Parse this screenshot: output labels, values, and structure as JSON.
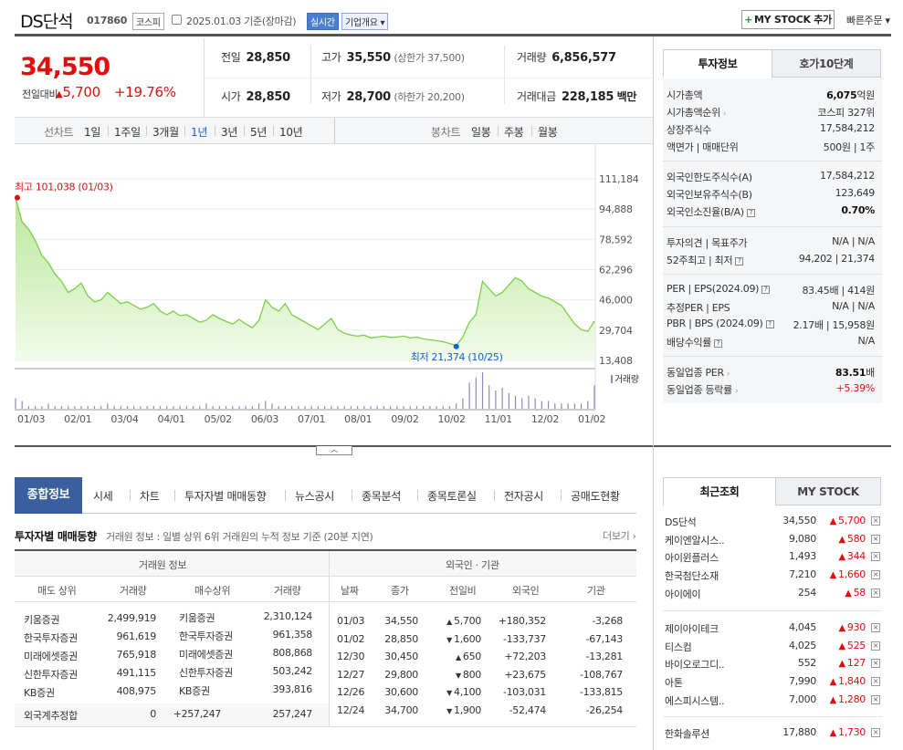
{
  "header": {
    "name": "DS단석",
    "code": "017860",
    "market": "코스피",
    "date": "2025.01.03 기준(장마감)",
    "realtime": "실시간",
    "company_info": "기업개요",
    "mystock": "MY STOCK 추가",
    "quick_order": "빠른주문"
  },
  "price": {
    "current": "34,550",
    "change_label": "전일대비",
    "change": "5,700",
    "change_pct": "+19.76%"
  },
  "quotes": {
    "prev_label": "전일",
    "prev": "28,850",
    "high_label": "고가",
    "high": "35,550",
    "upper_limit": "(상한가 37,500)",
    "volume_label": "거래량",
    "volume": "6,856,577",
    "open_label": "시가",
    "open": "28,850",
    "low_label": "저가",
    "low": "28,700",
    "lower_limit": "(하한가 20,200)",
    "amount_label": "거래대금",
    "amount": "228,185",
    "amount_unit": "백만"
  },
  "period_bar": {
    "line_label": "선차트",
    "line_items": [
      "1일",
      "1주일",
      "3개월",
      "1년",
      "3년",
      "5년",
      "10년"
    ],
    "active": "1년",
    "candle_label": "봉차트",
    "candle_items": [
      "일봉",
      "주봉",
      "월봉"
    ]
  },
  "chart_data": {
    "type": "area",
    "y_ticks": [
      "111,184",
      "94,888",
      "78,592",
      "62,296",
      "46,000",
      "29,704",
      "13,408"
    ],
    "ylim": [
      13408,
      111184
    ],
    "x_ticks": [
      "01/03",
      "02/01",
      "03/04",
      "04/01",
      "05/02",
      "06/03",
      "07/01",
      "08/01",
      "09/02",
      "10/02",
      "11/01",
      "12/02",
      "01/02"
    ],
    "max_label": "최고 101,038 (01/03)",
    "min_label": "최저 21,374 (10/25)",
    "volume_label": "거래량",
    "series": [
      {
        "values": [
          101038,
          88000,
          84000,
          78000,
          70000,
          66000,
          60000,
          56000,
          50000,
          52000,
          55000,
          48000,
          45000,
          46000,
          50000,
          47000,
          44000,
          45000,
          43000,
          41000,
          42000,
          44000,
          40000,
          38000,
          40000,
          37500,
          38000,
          36000,
          34000,
          35000,
          38000,
          36000,
          34500,
          33000,
          35500,
          33000,
          31000,
          35000,
          46000,
          42000,
          40000,
          44000,
          38000,
          36000,
          34000,
          32000,
          30000,
          33000,
          36000,
          30000,
          28000,
          27000,
          26500,
          27000,
          25500,
          26000,
          26500,
          25800,
          26000,
          26500,
          25500,
          26000,
          25000,
          24500,
          24000,
          23500,
          22500,
          21374,
          26000,
          34000,
          38000,
          56000,
          52000,
          48000,
          50000,
          54000,
          58000,
          56000,
          52000,
          50000,
          48000,
          47000,
          45000,
          43000,
          38000,
          33000,
          30000,
          29000,
          34550
        ]
      },
      {
        "name": "거래량",
        "values": [
          4,
          3,
          1,
          1,
          1,
          2,
          1,
          1,
          1,
          1,
          1,
          1,
          1,
          1,
          2,
          1,
          1,
          1,
          1,
          1,
          1,
          1,
          1,
          1,
          1,
          1,
          1,
          1,
          1,
          2,
          1,
          1,
          1,
          1,
          1,
          1,
          1,
          2,
          3,
          2,
          1,
          1,
          1,
          1,
          1,
          1,
          1,
          1,
          1,
          1,
          1,
          1,
          1,
          1,
          1,
          1,
          1,
          1,
          1,
          1,
          1,
          1,
          1,
          1,
          1,
          1,
          1,
          2,
          4,
          10,
          12,
          14,
          9,
          7,
          8,
          6,
          5,
          4,
          5,
          4,
          3,
          3,
          2,
          2,
          2,
          2,
          2,
          3,
          9
        ]
      }
    ]
  },
  "info_tabs": {
    "active": "투자정보",
    "other": "호가10단계"
  },
  "info": {
    "g1": [
      {
        "label": "시가총액",
        "value": "6,075",
        "unit": "억원"
      },
      {
        "label": "시가총액순위",
        "value": "코스피 327위"
      },
      {
        "label": "상장주식수",
        "value": "17,584,212"
      },
      {
        "label": "액면가 | 매매단위",
        "value": "500원 | 1주"
      }
    ],
    "g2": [
      {
        "label": "외국인한도주식수(A)",
        "value": "17,584,212"
      },
      {
        "label": "외국인보유주식수(B)",
        "value": "123,649"
      },
      {
        "label": "외국인소진율(B/A)",
        "value": "0.70%"
      }
    ],
    "g3": [
      {
        "label": "투자의견 | 목표주가",
        "value": "N/A | N/A"
      },
      {
        "label": "52주최고 | 최저",
        "value": "94,202 | 21,374"
      }
    ],
    "g4": [
      {
        "label": "PER | EPS(2024.09)",
        "value": "83.45배 | 414원"
      },
      {
        "label": "추정PER | EPS",
        "value": "N/A | N/A"
      },
      {
        "label": "PBR | BPS (2024.09)",
        "value": "2.17배 | 15,958원"
      },
      {
        "label": "배당수익률",
        "value": "N/A"
      }
    ],
    "g5": [
      {
        "label": "동일업종 PER",
        "value": "83.51",
        "unit": "배"
      },
      {
        "label": "동일업종 등락률",
        "value": "+5.39%"
      }
    ]
  },
  "lower_tabs": [
    "종합정보",
    "시세",
    "차트",
    "투자자별 매매동향",
    "뉴스공시",
    "종목분석",
    "종목토론실",
    "전자공시",
    "공매도현황"
  ],
  "trade": {
    "title": "투자자별 매매동향",
    "subtitle": "거래원 정보 : 일별 상위 6위 거래원의 누적 정보 기준 (20분 지연)",
    "more": "더보기",
    "group_left": "거래원 정보",
    "group_right": "외국인 · 기관",
    "headers_left": [
      "매도 상위",
      "거래량",
      "매수상위",
      "거래량"
    ],
    "headers_right": [
      "날짜",
      "종가",
      "전일비",
      "외국인",
      "기관"
    ],
    "left_rows": [
      [
        "키움증권",
        "2,499,919",
        "키움증권",
        "2,310,124"
      ],
      [
        "한국투자증권",
        "961,619",
        "한국투자증권",
        "961,358"
      ],
      [
        "미래에셋증권",
        "765,918",
        "미래에셋증권",
        "808,868"
      ],
      [
        "신한투자증권",
        "491,115",
        "신한투자증권",
        "503,242"
      ],
      [
        "KB증권",
        "408,975",
        "KB증권",
        "393,816"
      ]
    ],
    "foreign_row": [
      "외국계추정합",
      "0",
      "+257,247",
      "257,247"
    ],
    "right_rows": [
      [
        "01/03",
        "34,550",
        "5,700",
        "+180,352",
        "-3,268"
      ],
      [
        "01/02",
        "28,850",
        "1,600",
        "-133,737",
        "-67,143"
      ],
      [
        "12/30",
        "30,450",
        "650",
        "+72,203",
        "-13,281"
      ],
      [
        "12/27",
        "29,800",
        "800",
        "+23,675",
        "-108,767"
      ],
      [
        "12/26",
        "30,600",
        "4,100",
        "-103,031",
        "-133,815"
      ],
      [
        "12/24",
        "34,700",
        "1,900",
        "-52,474",
        "-26,254"
      ]
    ]
  },
  "recent_tabs": {
    "active": "최근조회",
    "other": "MY STOCK"
  },
  "recent_groups": [
    [
      {
        "name": "DS단석",
        "price": "34,550",
        "change": "5,700"
      },
      {
        "name": "케이엔알시스..",
        "price": "9,080",
        "change": "580"
      },
      {
        "name": "아이윈플러스",
        "price": "1,493",
        "change": "344"
      },
      {
        "name": "한국첨단소재",
        "price": "7,210",
        "change": "1,660"
      },
      {
        "name": "아이에이",
        "price": "254",
        "change": "58"
      }
    ],
    [
      {
        "name": "제이아이테크",
        "price": "4,045",
        "change": "930"
      },
      {
        "name": "티스컴",
        "price": "4,025",
        "change": "525"
      },
      {
        "name": "바이오로그디..",
        "price": "552",
        "change": "127"
      },
      {
        "name": "아톤",
        "price": "7,990",
        "change": "1,840"
      },
      {
        "name": "에스피시스템..",
        "price": "7,000",
        "change": "1,280"
      }
    ],
    [
      {
        "name": "한화솔루션",
        "price": "17,880",
        "change": "1,730"
      }
    ]
  ]
}
